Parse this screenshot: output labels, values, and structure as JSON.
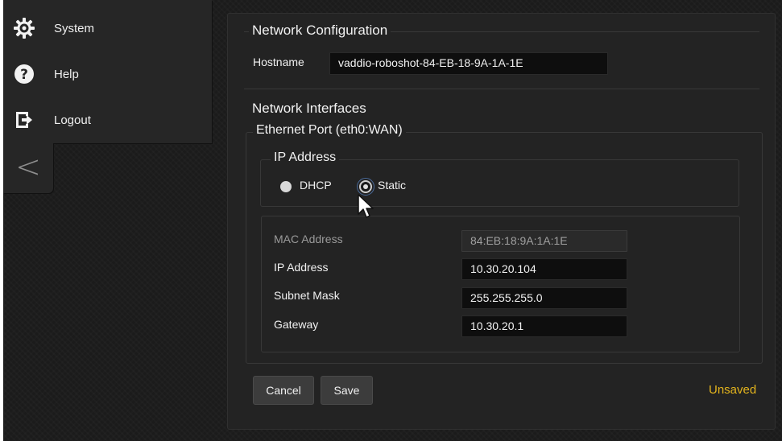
{
  "sidebar": {
    "items": [
      {
        "label": "System",
        "icon": "gear-icon"
      },
      {
        "label": "Help",
        "icon": "help-icon"
      },
      {
        "label": "Logout",
        "icon": "logout-icon"
      }
    ],
    "collapse_glyph": "<"
  },
  "config": {
    "title": "Network Configuration",
    "hostname_label": "Hostname",
    "hostname_value": "vaddio-roboshot-84-EB-18-9A-1A-1E",
    "interfaces_title": "Network Interfaces",
    "ethernet_title": "Ethernet Port (eth0:WAN)",
    "ip_mode": {
      "title": "IP Address",
      "options": [
        "DHCP",
        "Static"
      ],
      "selected": "Static"
    },
    "fields": {
      "mac_label": "MAC Address",
      "mac_value": "84:EB:18:9A:1A:1E",
      "ip_label": "IP Address",
      "ip_value": "10.30.20.104",
      "subnet_label": "Subnet Mask",
      "subnet_value": "255.255.255.0",
      "gateway_label": "Gateway",
      "gateway_value": "10.30.20.1"
    },
    "buttons": {
      "cancel": "Cancel",
      "save": "Save"
    },
    "status": "Unsaved"
  },
  "colors": {
    "status": "#e3b41d",
    "panel": "#232323",
    "background": "#1b1b1b"
  }
}
